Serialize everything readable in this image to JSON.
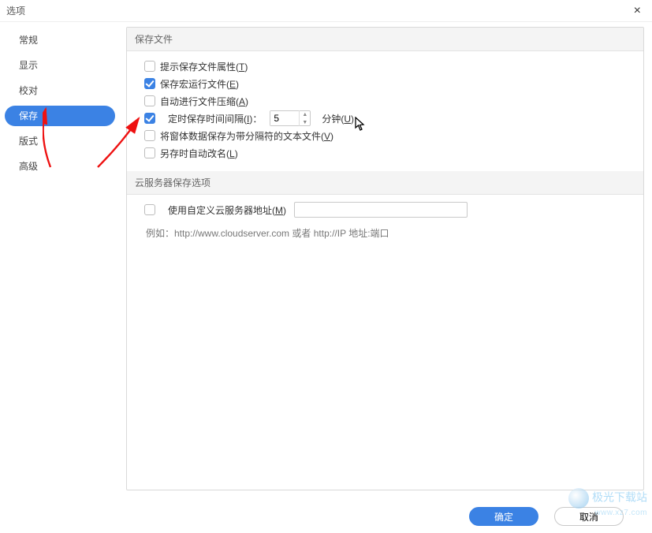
{
  "window": {
    "title": "选项",
    "close": "×"
  },
  "sidebar": {
    "items": [
      {
        "label": "常规"
      },
      {
        "label": "显示"
      },
      {
        "label": "校对"
      },
      {
        "label": "保存"
      },
      {
        "label": "版式"
      },
      {
        "label": "高级"
      }
    ]
  },
  "section_save": {
    "header": "保存文件",
    "prompt_attrs": {
      "pre": "提示保存文件属性(",
      "hot": "T",
      "post": ")"
    },
    "save_macro": {
      "pre": "保存宏运行文件(",
      "hot": "E",
      "post": ")"
    },
    "auto_compress": {
      "pre": "自动进行文件压缩(",
      "hot": "A",
      "post": ")"
    },
    "timed_save": {
      "pre": "定时保存时间间隔(",
      "hot": "I",
      "post": ")：",
      "value": "5",
      "unit_pre": "分钟(",
      "unit_hot": "U",
      "unit_post": ")"
    },
    "form_sep": {
      "pre": "将窗体数据保存为带分隔符的文本文件(",
      "hot": "V",
      "post": ")"
    },
    "auto_rename": {
      "pre": "另存时自动改名(",
      "hot": "L",
      "post": ")"
    }
  },
  "section_cloud": {
    "header": "云服务器保存选项",
    "custom_addr": {
      "pre": "使用自定义云服务器地址(",
      "hot": "M",
      "post": ")"
    },
    "hint": "例如：http://www.cloudserver.com 或者 http://IP 地址:端口"
  },
  "footer": {
    "ok": "确定",
    "cancel": "取消"
  },
  "watermark": {
    "line1": "极光下载站",
    "line2": "www.xz7.com"
  }
}
